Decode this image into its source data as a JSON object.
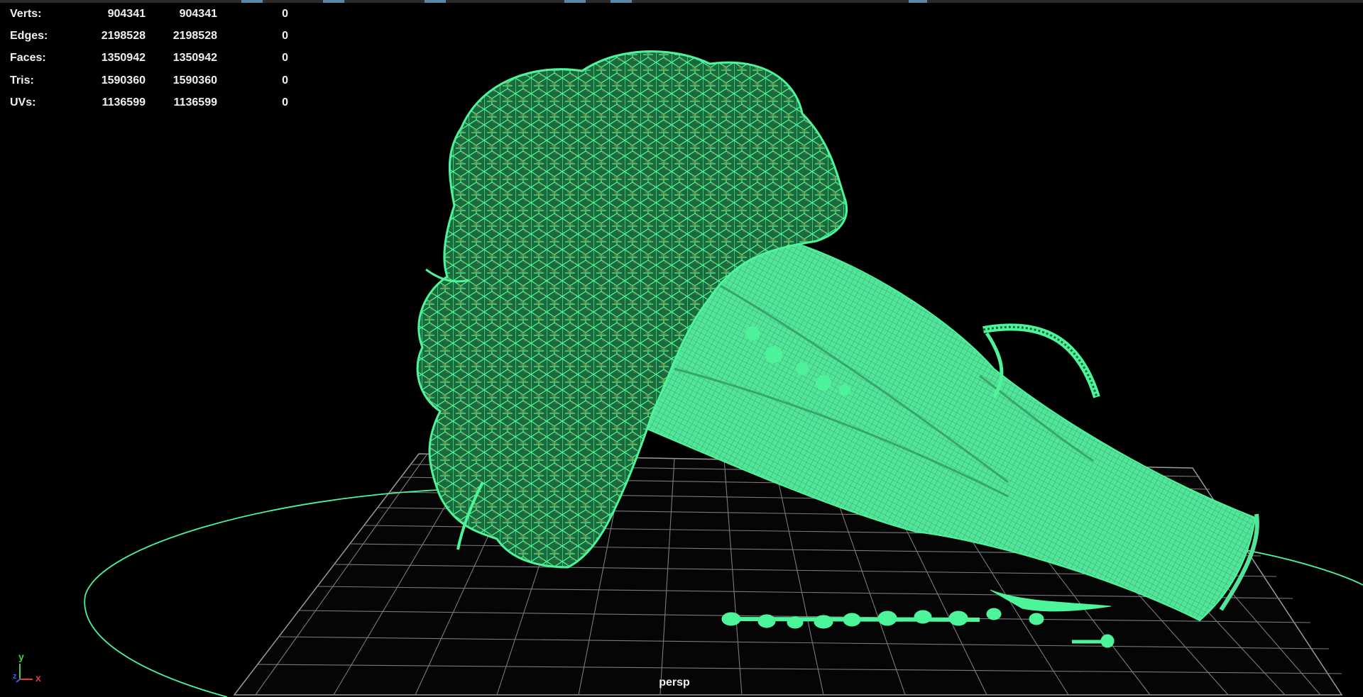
{
  "viewport": {
    "camera_label": "persp"
  },
  "heads_up_display": {
    "rows": [
      {
        "label": "Verts:",
        "total": "904341",
        "selected": "904341",
        "triangles": "0"
      },
      {
        "label": "Edges:",
        "total": "2198528",
        "selected": "2198528",
        "triangles": "0"
      },
      {
        "label": "Faces:",
        "total": "1350942",
        "selected": "1350942",
        "triangles": "0"
      },
      {
        "label": "Tris:",
        "total": "1590360",
        "selected": "1590360",
        "triangles": "0"
      },
      {
        "label": "UVs:",
        "total": "1136599",
        "selected": "1136599",
        "triangles": "0"
      }
    ]
  },
  "axis_gizmo": {
    "y_label": "y",
    "z_label": "z",
    "x_label": "x"
  },
  "colors": {
    "background": "#000000",
    "wireframe": "#4df59a",
    "grid": "#8a8a8a",
    "hud_text": "#f0f0f0",
    "axis_x": "#e23b3b",
    "axis_y": "#3fd13f",
    "axis_z": "#3a5cff"
  }
}
